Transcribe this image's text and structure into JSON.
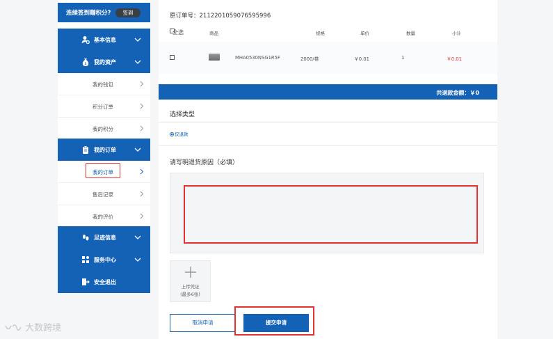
{
  "sidebar": {
    "signin_text": "连续签到赚积分?",
    "signin_button": "签到",
    "groups": {
      "basic": "基本信息",
      "assets": "我的资产",
      "orders": "我的订单",
      "footprint": "足迹信息",
      "service": "服务中心",
      "logout": "安全退出"
    },
    "assets_items": [
      "我的钱包",
      "积分订单",
      "我的积分"
    ],
    "orders_items": [
      "我的订单",
      "售后记录",
      "我的评价"
    ],
    "active_item": "我的订单"
  },
  "order": {
    "original_no": "原订单号：2112201059076595996",
    "select_all": "全选",
    "headers": {
      "product": "商品",
      "spec": "规格",
      "unit_price": "单价",
      "qty": "数量",
      "subtotal": "小计"
    },
    "rows": [
      {
        "model": "MHA0530NSG1R5F",
        "spec": "2000/卷",
        "unit_price": "￥0.01",
        "qty": "1",
        "subtotal": "￥0.01"
      }
    ],
    "refund_total": "共退款金额：￥0"
  },
  "form": {
    "type_title": "选择类型",
    "type_option": "仅退款",
    "reason_title": "请写明退货原因（必填）",
    "reason_value": "",
    "upload_label": "上传凭证",
    "upload_limit": "(最多6张)",
    "cancel_button": "取消申请",
    "submit_button": "提交申请"
  },
  "watermark": "大数跨境",
  "colors": {
    "primary": "#1462b6",
    "annotation": "#e43131",
    "price": "#e43131"
  }
}
